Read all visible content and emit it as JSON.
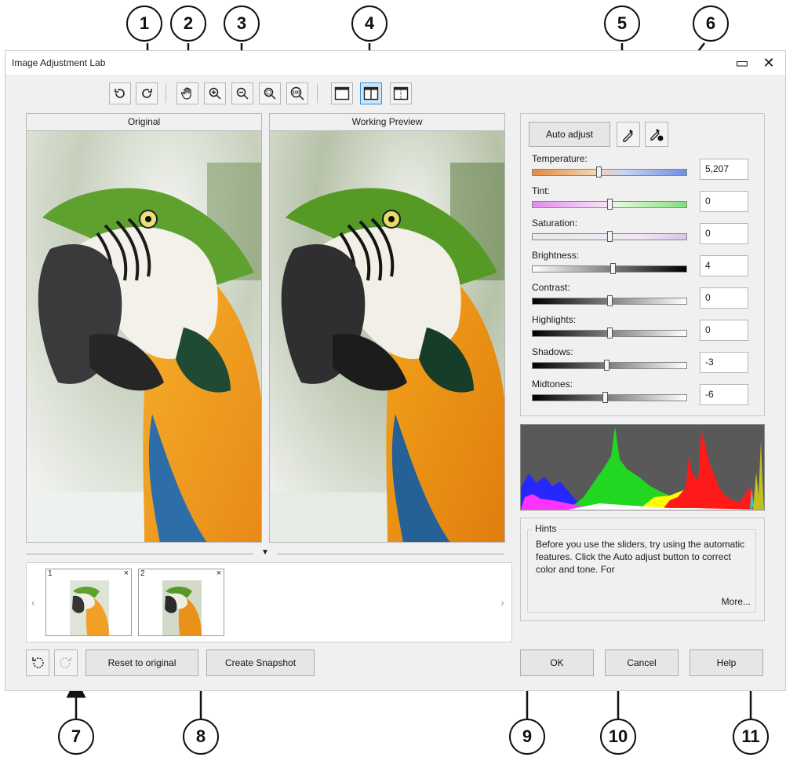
{
  "window": {
    "title": "Image Adjustment Lab",
    "maximize_glyph": "▭",
    "close_glyph": "✕"
  },
  "callouts": [
    "1",
    "2",
    "3",
    "4",
    "5",
    "6",
    "7",
    "8",
    "9",
    "10",
    "11"
  ],
  "toolbar": {
    "icons": [
      "rotate-left-icon",
      "rotate-right-icon",
      "pan-hand-icon",
      "zoom-in-icon",
      "zoom-out-icon",
      "zoom-fit-icon",
      "zoom-100-icon",
      "full-preview-icon",
      "split-preview-icon",
      "before-after-preview-icon"
    ],
    "zoom_100_text": "100"
  },
  "panes": {
    "original": "Original",
    "preview": "Working Preview"
  },
  "snapshots": [
    {
      "number": "1",
      "close": "×"
    },
    {
      "number": "2",
      "close": "×"
    }
  ],
  "snapshot_strip": {
    "prev": "‹",
    "next": "›",
    "collapse": "▼"
  },
  "bottom_left": {
    "undo_icon": "undo-icon",
    "redo_icon": "redo-icon",
    "reset": "Reset to original",
    "snapshot": "Create Snapshot"
  },
  "adjust": {
    "auto_adjust": "Auto adjust",
    "white_point_icon": "eyedropper-white-icon",
    "black_point_icon": "eyedropper-black-icon",
    "sliders": [
      {
        "label": "Temperature:",
        "value": "5,207",
        "level": 0.43,
        "gradient": "linear-gradient(90deg,#e58a3c,#f3d4b6 40%,#c8d4f1 60%,#6f8ee5)"
      },
      {
        "label": "Tint:",
        "value": "0",
        "level": 0.5,
        "gradient": "linear-gradient(90deg,#e58aeb,#f4dff7 45%,#e3f7d9 55%,#83e07c)"
      },
      {
        "label": "Saturation:",
        "value": "0",
        "level": 0.5,
        "gradient": "linear-gradient(90deg,#e9e9e9,#efe7f4 70%,#d6c5ea)"
      },
      {
        "label": "Brightness:",
        "value": "4",
        "level": 0.52,
        "gradient": "linear-gradient(90deg,#ffffff,#000000)"
      },
      {
        "label": "Contrast:",
        "value": "0",
        "level": 0.5,
        "gradient": "linear-gradient(90deg,#000000,#ffffff)"
      },
      {
        "label": "Highlights:",
        "value": "0",
        "level": 0.5,
        "gradient": "linear-gradient(90deg,#000000,#ffffff)"
      },
      {
        "label": "Shadows:",
        "value": "-3",
        "level": 0.48,
        "gradient": "linear-gradient(90deg,#000000,#ffffff)"
      },
      {
        "label": "Midtones:",
        "value": "-6",
        "level": 0.47,
        "gradient": "linear-gradient(90deg,#000000,#ffffff)"
      }
    ]
  },
  "hints": {
    "title": "Hints",
    "text": "Before you use the sliders, try using the automatic features. Click the Auto adjust button to correct color and tone. For",
    "more": "More..."
  },
  "dialog_buttons": {
    "ok": "OK",
    "cancel": "Cancel",
    "help": "Help"
  },
  "colors": {
    "accent": "#3c8fd6",
    "window_bg": "#f0f0f0",
    "histogram_bg": "#5a5a5a"
  }
}
